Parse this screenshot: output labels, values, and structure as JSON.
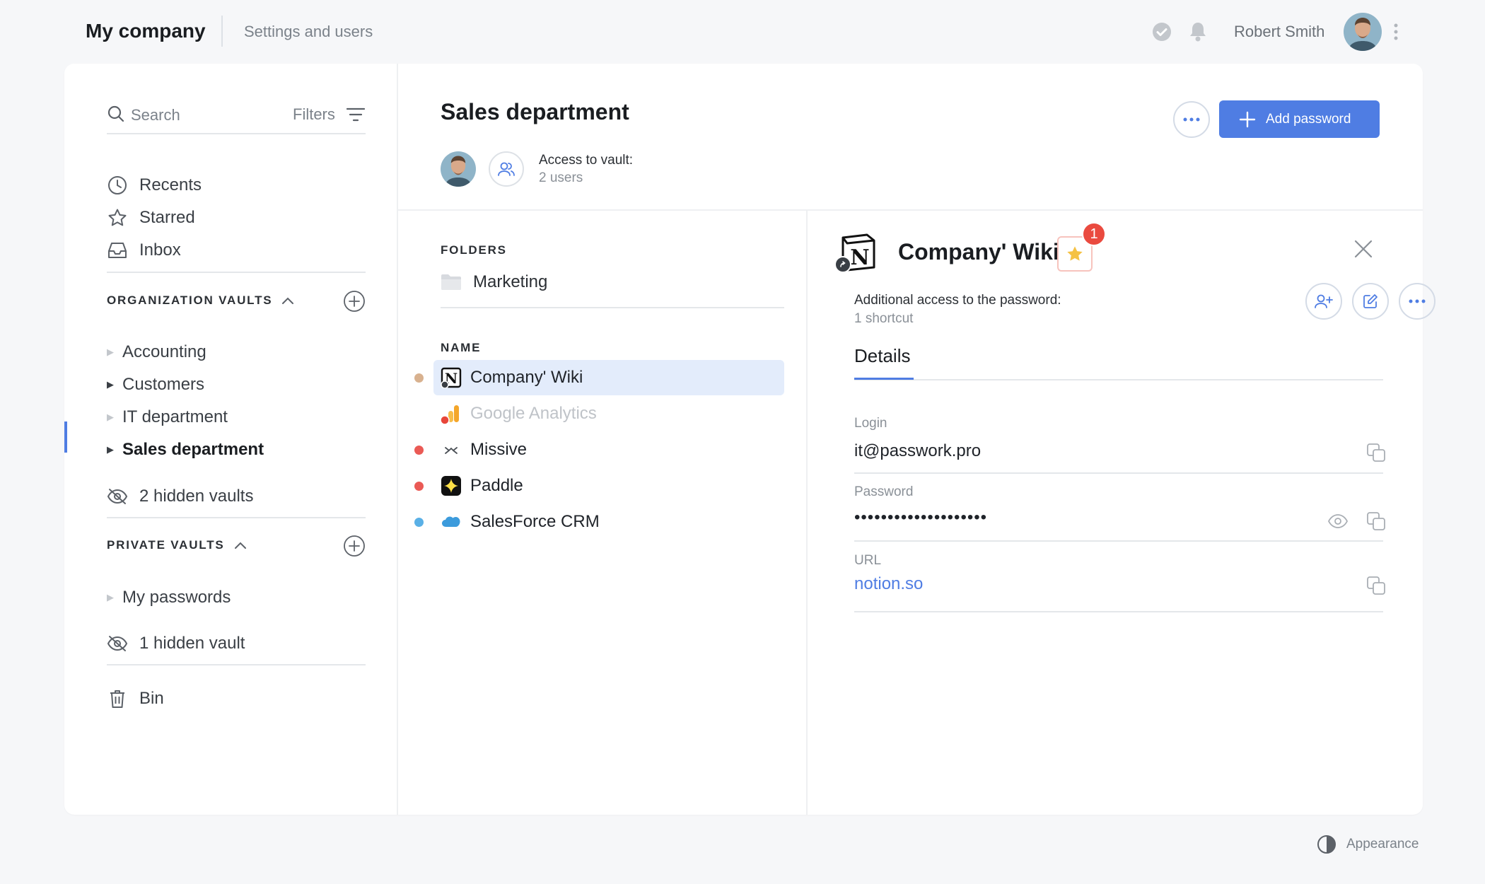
{
  "topbar": {
    "brand": "My company",
    "settings_link": "Settings and users",
    "user_name": "Robert Smith"
  },
  "sidebar": {
    "search_placeholder": "Search",
    "filters_label": "Filters",
    "nav": [
      {
        "label": "Recents",
        "icon": "clock-icon"
      },
      {
        "label": "Starred",
        "icon": "star-icon"
      },
      {
        "label": "Inbox",
        "icon": "inbox-icon"
      }
    ],
    "org_section_title": "ORGANIZATION VAULTS",
    "org_vaults": [
      "Accounting",
      "Customers",
      "IT department",
      "Sales department"
    ],
    "org_hidden": "2 hidden vaults",
    "private_section_title": "PRIVATE VAULTS",
    "private_vaults": [
      "My passwords"
    ],
    "private_hidden": "1 hidden vault",
    "bin_label": "Bin"
  },
  "vault": {
    "title": "Sales department",
    "access_label": "Access to vault:",
    "access_count": "2 users",
    "add_password_label": "Add password"
  },
  "list": {
    "folders_header": "FOLDERS",
    "folders": [
      "Marketing"
    ],
    "name_header": "NAME",
    "items": [
      {
        "name": "Company' Wiki",
        "dot_color": "#d8b18f",
        "icon": "notion-icon"
      },
      {
        "name": "Google Analytics",
        "dot_color": "",
        "icon": "analytics-icon"
      },
      {
        "name": "Missive",
        "dot_color": "#ea5a55",
        "icon": "missive-icon"
      },
      {
        "name": "Paddle",
        "dot_color": "#ea5a55",
        "icon": "paddle-icon"
      },
      {
        "name": "SalesForce CRM",
        "dot_color": "#5ab0e6",
        "icon": "salesforce-icon"
      }
    ]
  },
  "detail": {
    "title": "Company' Wiki",
    "notification_count": "1",
    "access_label": "Additional access to the password:",
    "access_count": "1 shortcut",
    "tab": "Details",
    "login_label": "Login",
    "login_value": "it@passwork.pro",
    "password_label": "Password",
    "password_value": "••••••••••••••••••••",
    "url_label": "URL",
    "url_value": "notion.so"
  },
  "footer": {
    "appearance_label": "Appearance"
  },
  "colors": {
    "accent": "#4f7de3",
    "selected_row": "#e3ecfb",
    "notification": "#ea4a3f",
    "star": "#f5c243"
  }
}
